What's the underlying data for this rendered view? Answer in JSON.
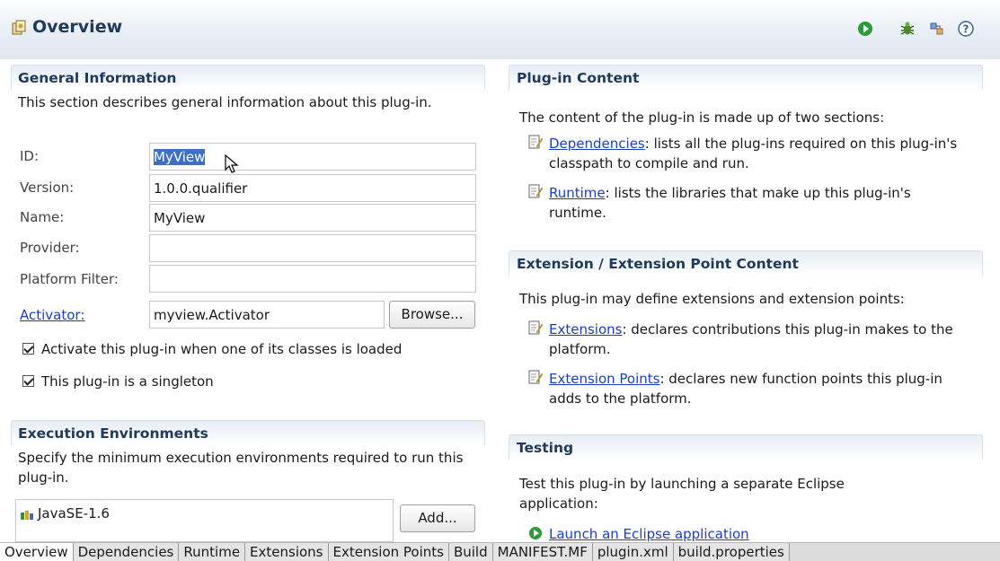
{
  "header": {
    "title": "Overview",
    "icons": [
      "manifest-icon",
      "run-icon",
      "debug-icon",
      "export-icon",
      "help-icon"
    ]
  },
  "general": {
    "title": "General Information",
    "description": "This section describes general information about this plug-in.",
    "id_label": "ID:",
    "id_value": "MyView",
    "version_label": "Version:",
    "version_value": "1.0.0.qualifier",
    "name_label": "Name:",
    "name_value": "MyView",
    "provider_label": "Provider:",
    "provider_value": "",
    "platform_label": "Platform Filter:",
    "platform_value": "",
    "activator_label": "Activator:",
    "activator_value": "myview.Activator",
    "browse_label": "Browse...",
    "check_activate": "Activate this plug-in when one of its classes is loaded",
    "check_singleton": "This plug-in is a singleton"
  },
  "execution": {
    "title": "Execution Environments",
    "description": "Specify the minimum execution environments required to run this plug-in.",
    "items": [
      "JavaSE-1.6"
    ],
    "add_label": "Add..."
  },
  "content": {
    "title": "Plug-in Content",
    "intro": "The content of the plug-in is made up of two sections:",
    "dep_link": "Dependencies",
    "dep_text": ": lists all the plug-ins required on this plug-in's classpath to compile and run.",
    "rt_link": "Runtime",
    "rt_text": ": lists the libraries that make up this plug-in's runtime."
  },
  "extension": {
    "title": "Extension / Extension Point Content",
    "intro": "This plug-in may define extensions and extension points:",
    "ext_link": "Extensions",
    "ext_text": ": declares contributions this plug-in makes to the platform.",
    "pts_link": "Extension Points",
    "pts_text": ": declares new function points this plug-in adds to the platform."
  },
  "testing": {
    "title": "Testing",
    "intro": "Test this plug-in by launching a separate Eclipse application:",
    "launch_link": "Launch an Eclipse application"
  },
  "tabs": [
    "Overview",
    "Dependencies",
    "Runtime",
    "Extensions",
    "Extension Points",
    "Build",
    "MANIFEST.MF",
    "plugin.xml",
    "build.properties"
  ],
  "colors": {
    "header_title": "#1f3a5c",
    "link": "#1a3fc4",
    "selection": "#3d6fc4"
  }
}
